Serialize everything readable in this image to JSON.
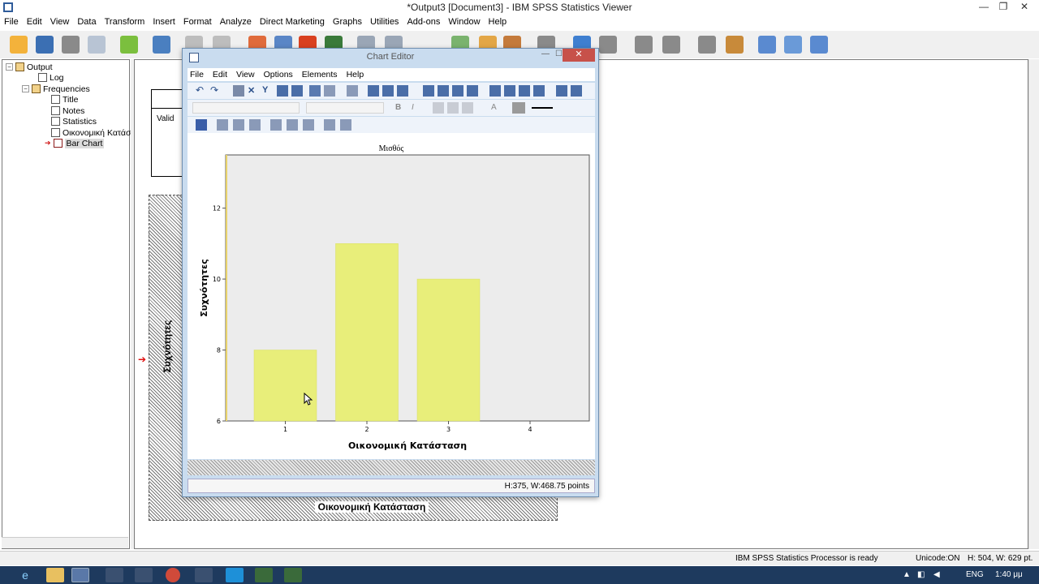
{
  "window": {
    "title": "*Output3 [Document3] - IBM SPSS Statistics Viewer",
    "minimize": "—",
    "restore": "❐",
    "close": "✕"
  },
  "menubar": [
    "File",
    "Edit",
    "View",
    "Data",
    "Transform",
    "Insert",
    "Format",
    "Analyze",
    "Direct Marketing",
    "Graphs",
    "Utilities",
    "Add-ons",
    "Window",
    "Help"
  ],
  "outline": {
    "root": "Output",
    "log": "Log",
    "frequencies": "Frequencies",
    "title": "Title",
    "notes": "Notes",
    "statistics": "Statistics",
    "table": "Οικονομική Κατάσ",
    "bar_chart": "Bar Chart"
  },
  "viewer_bg": {
    "valid": "Valid",
    "ylabel": "Συχνότητες",
    "xlabel": "Οικονομική Κατάσταση"
  },
  "chart_editor": {
    "title": "Chart Editor",
    "close": "✕",
    "menu": [
      "File",
      "Edit",
      "View",
      "Options",
      "Elements",
      "Help"
    ],
    "status": "H:375, W:468.75 points",
    "bold": "B",
    "italic": "I"
  },
  "chart_data": {
    "type": "bar",
    "title": "Μισθός",
    "xlabel": "Οικονομική Κατάσταση",
    "ylabel": "Συχνότητες",
    "categories": [
      "1",
      "2",
      "3",
      "4"
    ],
    "values": [
      8,
      11,
      10,
      6
    ],
    "ylim": [
      6,
      13.5
    ],
    "yticks": [
      6,
      8,
      10,
      12
    ],
    "bar_color": "#e8ee7a",
    "grid": false
  },
  "statusbar": {
    "processor": "IBM SPSS Statistics Processor is ready",
    "unicode": "Unicode:ON",
    "size": "H: 504, W: 629 pt."
  },
  "taskbar": {
    "lang": "ENG",
    "time": "1:40 μμ"
  }
}
